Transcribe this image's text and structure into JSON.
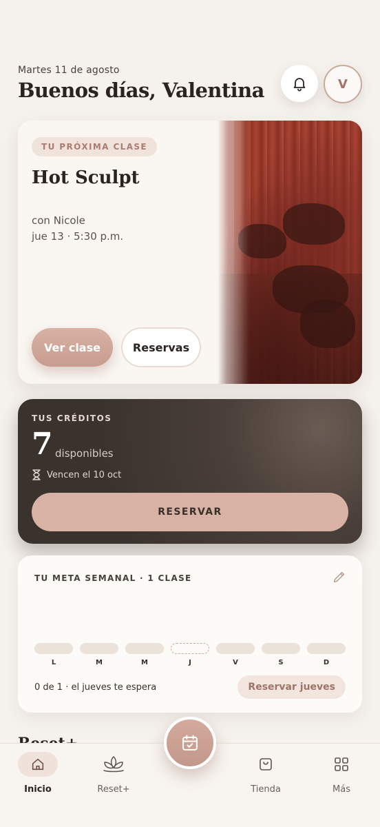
{
  "header": {
    "date": "Martes 11 de agosto",
    "greeting": "Buenos días, Valentina",
    "avatar_initial": "V"
  },
  "next_class": {
    "tag": "TU PRÓXIMA CLASE",
    "name": "Hot Sculpt",
    "instructor": "con Nicole",
    "datetime": "jue 13 · 5:30 p.m.",
    "primary_button": "Ver clase",
    "secondary_button": "Reservas"
  },
  "credits": {
    "title": "TUS CRÉDITOS",
    "count": "7",
    "count_label": "disponibles",
    "expires": "Vencen el 10 oct",
    "reserve_button": "RESERVAR"
  },
  "weekly_goal": {
    "title": "TU META SEMANAL · 1 CLASE",
    "days": [
      {
        "letter": "L",
        "state": "empty"
      },
      {
        "letter": "M",
        "state": "empty"
      },
      {
        "letter": "M",
        "state": "empty"
      },
      {
        "letter": "J",
        "state": "target"
      },
      {
        "letter": "V",
        "state": "empty"
      },
      {
        "letter": "S",
        "state": "empty"
      },
      {
        "letter": "D",
        "state": "empty"
      }
    ],
    "status": "0 de 1 · el jueves te espera",
    "action_button": "Reservar jueves"
  },
  "next_section_title": "Reset+",
  "nav": {
    "items": [
      {
        "label": "Inicio",
        "icon": "home-icon",
        "active": true
      },
      {
        "label": "Reset+",
        "icon": "lotus-icon",
        "active": false
      },
      {
        "label": "Tienda",
        "icon": "shopping-bag-icon",
        "active": false
      },
      {
        "label": "Más",
        "icon": "grid-icon",
        "active": false
      }
    ],
    "fab_icon": "calendar-check-icon"
  },
  "colors": {
    "background": "#f5f1ec",
    "accent": "#c79c8e",
    "dark_card": "#3a322d",
    "text": "#2b2320"
  }
}
